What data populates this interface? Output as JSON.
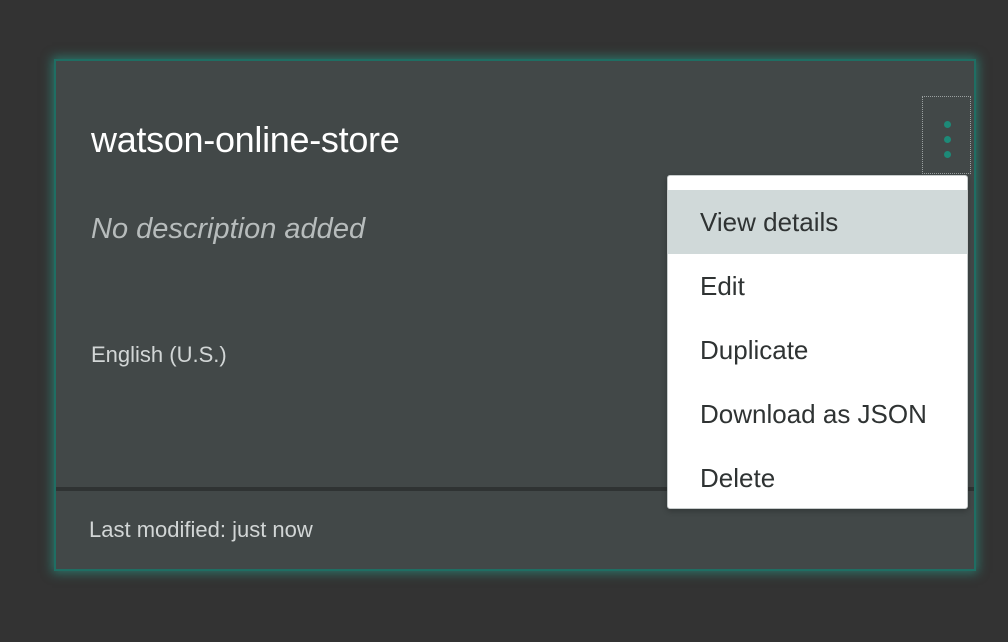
{
  "card": {
    "title": "watson-online-store",
    "description": "No description added",
    "language": "English (U.S.)",
    "last_modified": "Last modified: just now"
  },
  "overflow_menu": {
    "icon": "vertical-ellipsis-icon",
    "items": [
      {
        "label": "View details",
        "highlighted": true
      },
      {
        "label": "Edit"
      },
      {
        "label": "Duplicate"
      },
      {
        "label": "Download as JSON"
      },
      {
        "label": "Delete"
      }
    ]
  },
  "colors": {
    "background": "#333333",
    "card": "#424848",
    "accent": "#1d8a78",
    "menu_highlight": "#d0d9d9"
  }
}
